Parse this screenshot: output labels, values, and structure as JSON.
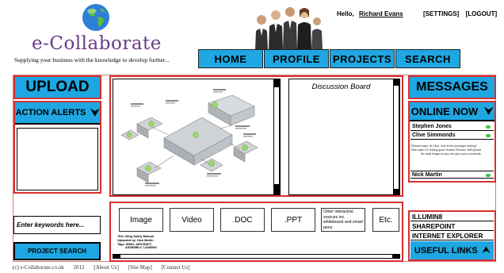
{
  "brand": {
    "name": "e-Collaborate",
    "tagline": "Supplying your business with the knowledge to develop further..."
  },
  "user": {
    "greeting": "Hello,",
    "name": "Richard Evans"
  },
  "top_links": [
    "[SETTINGS]",
    "[LOGOUT]"
  ],
  "nav": [
    "HOME",
    "PROFILE",
    "PROJECTS",
    "SEARCH"
  ],
  "left": {
    "upload": "UPLOAD",
    "alerts": "ACTION ALERTS",
    "search_placeholder": "Enter keywords here...",
    "search_button": "PROJECT SEARCH"
  },
  "discussion": {
    "title": "Discussion Board"
  },
  "file_types": [
    "Image",
    "Video",
    ".DOC",
    ".PPT",
    "Etc."
  ],
  "file_other": "Other interactive sources inc. whiteboard and smart pens.",
  "file_meta": [
    "Title: Wing Safety Manual",
    "Uploaded by: Nick Martin",
    "Tags: WING; AIRCRAFT;",
    "ASSEMBLY; LANDING"
  ],
  "right": {
    "messages": "MESSAGES",
    "online_now": "ONLINE NOW",
    "contacts": [
      "Stephen Jones",
      "Clive Simmonds",
      "Nick Martin"
    ],
    "chat": [
      "Richard says: Hi Clive, how is the prototype testing?",
      "Nick says: It's testing good, thanks Richard. Will upload",
      "the draft image so you can give your comments."
    ],
    "status_color": "#43c443"
  },
  "links": [
    "ILLUMIN8",
    "SHAREPOINT",
    "INTERNET EXPLORER"
  ],
  "useful_links": "USEFUL LINKS",
  "footer": [
    "(c) e-Collaborate.co.uk",
    "2012",
    "[About Us]",
    "[Site Map]",
    "[Contact Us]"
  ],
  "colors": {
    "accent": "#1ea7e2",
    "border": "#d73030",
    "brand": "#6a3a8a"
  }
}
